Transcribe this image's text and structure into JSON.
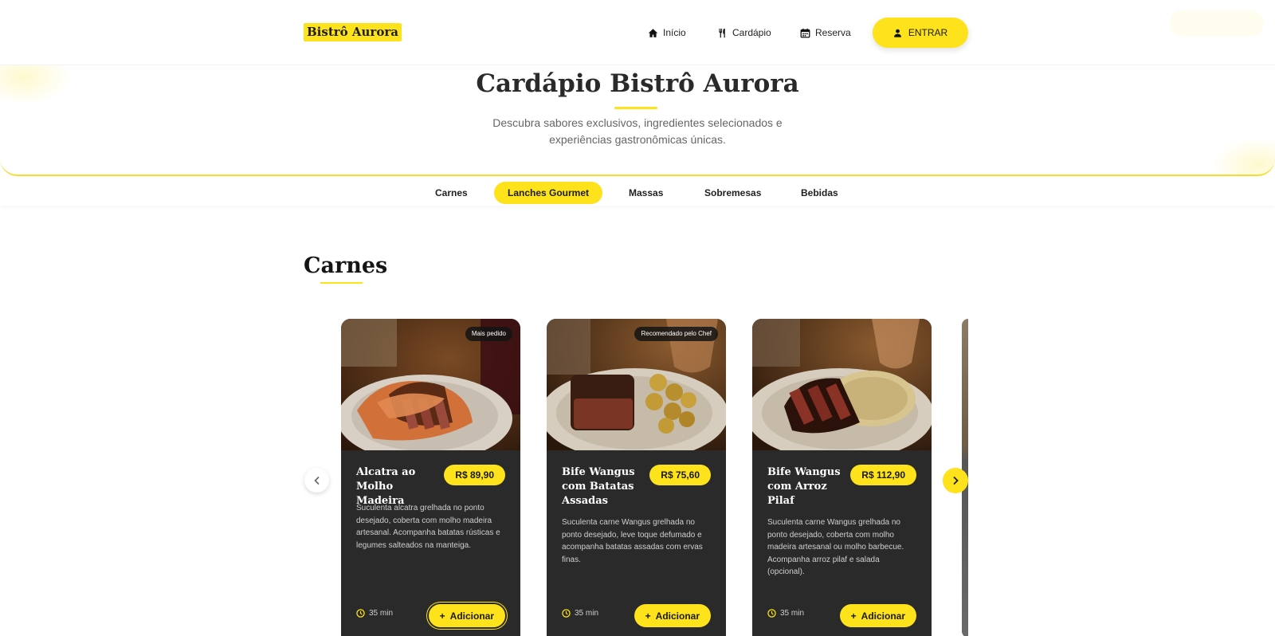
{
  "header": {
    "logo": "Bistrô Aurora",
    "nav": [
      {
        "label": "Início",
        "icon": "home-icon"
      },
      {
        "label": "Cardápio",
        "icon": "utensils-icon"
      },
      {
        "label": "Reserva",
        "icon": "calendar-icon"
      }
    ],
    "login_label": "ENTRAR"
  },
  "hero": {
    "title": "Cardápio Bistrô Aurora",
    "subtitle": "Descubra sabores exclusivos, ingredientes selecionados e experiências gastronômicas únicas."
  },
  "categories": {
    "items": [
      "Carnes",
      "Lanches Gourmet",
      "Massas",
      "Sobremesas",
      "Bebidas"
    ],
    "active": "Lanches Gourmet"
  },
  "section": {
    "title": "Carnes"
  },
  "cards": [
    {
      "badge": "Mais pedido",
      "name": "Alcatra ao Molho Madeira",
      "price": "R$ 89,90",
      "description": "Suculenta alcatra grelhada no ponto desejado, coberta com molho madeira artesanal. Acompanha batatas rústicas e legumes salteados na manteiga.",
      "time": "35 min",
      "add_label": "Adicionar"
    },
    {
      "badge": "Recomendado pelo Chef",
      "name": "Bife Wangus com Batatas Assadas",
      "price": "R$ 75,60",
      "description": "Suculenta carne Wangus grelhada no ponto desejado, leve toque defumado e acompanha batatas assadas com ervas finas.",
      "time": "35 min",
      "add_label": "Adicionar"
    },
    {
      "badge": "",
      "name": "Bife Wangus com Arroz Pilaf",
      "price": "R$ 112,90",
      "description": "Suculenta carne Wangus grelhada no ponto desejado, coberta com molho madeira artesanal ou molho barbecue. Acompanha arroz pilaf e salada (opcional).",
      "time": "35 min",
      "add_label": "Adicionar"
    }
  ],
  "colors": {
    "accent": "#fde21c",
    "card_bg": "#2a2a2a",
    "text_dark": "#1f1f1f"
  }
}
